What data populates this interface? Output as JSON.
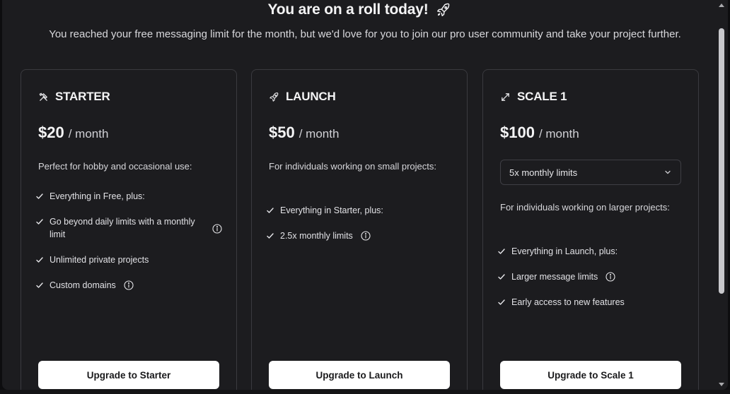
{
  "dialog": {
    "title": "You are on a roll today!",
    "title_icon": "rocket-icon",
    "subtitle": "You reached your free messaging limit for the month, but we'd love for you to join our pro user community and take your project further."
  },
  "plans": [
    {
      "name": "STARTER",
      "icon": "tools-icon",
      "price": "$20",
      "period": "/ month",
      "description": "Perfect for hobby and occasional use:",
      "features": [
        {
          "text": "Everything in Free, plus:",
          "info": false
        },
        {
          "text": "Go beyond daily limits with a monthly limit",
          "info": true
        },
        {
          "text": "Unlimited private projects",
          "info": false
        },
        {
          "text": "Custom domains",
          "info": true
        }
      ],
      "button": "Upgrade to Starter"
    },
    {
      "name": "LAUNCH",
      "icon": "rocket-icon",
      "price": "$50",
      "period": "/ month",
      "description": "For individuals working on small projects:",
      "features": [
        {
          "text": "Everything in Starter, plus:",
          "info": false
        },
        {
          "text": "2.5x monthly limits",
          "info": true
        }
      ],
      "button": "Upgrade to Launch"
    },
    {
      "name": "SCALE 1",
      "icon": "expand-icon",
      "price": "$100",
      "period": "/ month",
      "select_value": "5x monthly limits",
      "description": "For individuals working on larger projects:",
      "features": [
        {
          "text": "Everything in Launch, plus:",
          "info": false
        },
        {
          "text": "Larger message limits",
          "info": true
        },
        {
          "text": "Early access to new features",
          "info": false
        }
      ],
      "button": "Upgrade to Scale 1"
    }
  ],
  "colors": {
    "background": "#1c1c1f",
    "card_border": "#3a3a3f",
    "button_bg": "#ffffff",
    "button_text": "#1a1a1c"
  }
}
